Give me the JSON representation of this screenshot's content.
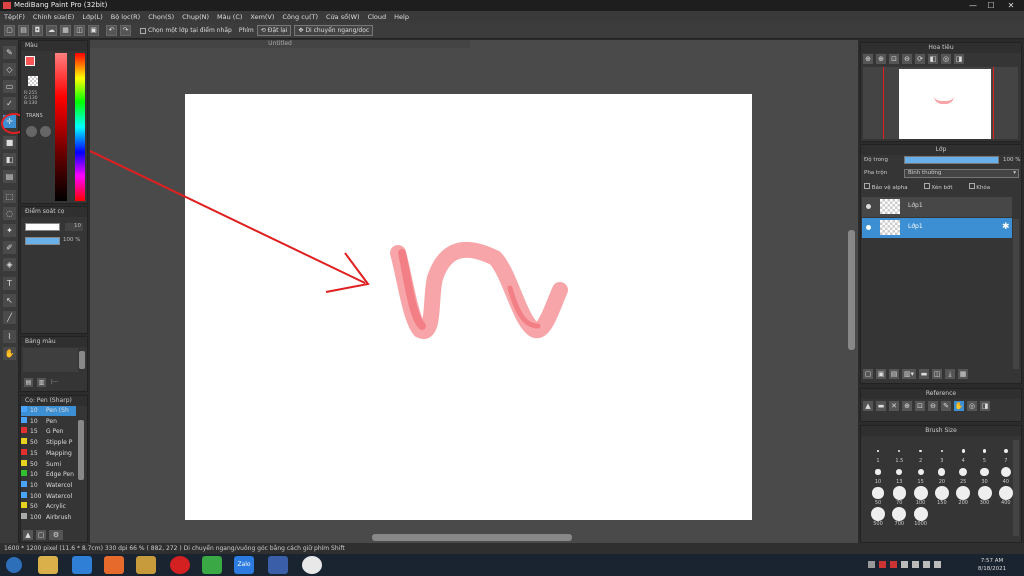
{
  "window": {
    "title": "MediBang Paint Pro (32bit)",
    "min": "—",
    "max": "☐",
    "close": "✕"
  },
  "menu": [
    "Tệp(F)",
    "Chỉnh sửa(E)",
    "Lớp(L)",
    "Bộ lọc(R)",
    "Chọn(S)",
    "Chụp(N)",
    "Màu (C)",
    "Xem(V)",
    "Công cụ(T)",
    "Cửa sổ(W)",
    "Cloud",
    "Help"
  ],
  "toolbar": {
    "select_layer": "Chọn một lớp tại điểm nhấp",
    "key_label": "Phím",
    "rotate": "Đặt lại",
    "move": "Di chuyển ngang/dọc"
  },
  "canvas": {
    "tab": "Untitled"
  },
  "color_panel": {
    "title": "Màu",
    "r": "R:255",
    "g": "G:130",
    "b": "B:130",
    "mode": "TRANS",
    "accent": "#ff8282"
  },
  "brush_control": {
    "title": "Điểm soát cọ",
    "size": "10",
    "opacity": "100 %"
  },
  "palette": {
    "title": "Bảng màu",
    "add_label": "|---"
  },
  "brush_list": {
    "title": "Cọ: Pen (Sharp)",
    "items": [
      {
        "size": "10",
        "name": "Pen (Sh",
        "color": "#4aa3ff"
      },
      {
        "size": "10",
        "name": "Pen",
        "color": "#4aa3ff"
      },
      {
        "size": "15",
        "name": "G Pen",
        "color": "#e03030"
      },
      {
        "size": "50",
        "name": "Stipple P",
        "color": "#e8d020"
      },
      {
        "size": "15",
        "name": "Mapping",
        "color": "#e03030"
      },
      {
        "size": "50",
        "name": "Sumi",
        "color": "#e8d020"
      },
      {
        "size": "10",
        "name": "Edge Pen",
        "color": "#30c030"
      },
      {
        "size": "10",
        "name": "Watercol",
        "color": "#4aa3ff"
      },
      {
        "size": "100",
        "name": "Watercol",
        "color": "#4aa3ff"
      },
      {
        "size": "50",
        "name": "Acrylic",
        "color": "#e8d020"
      },
      {
        "size": "100",
        "name": "Airbrush",
        "color": "#aaaaaa"
      }
    ]
  },
  "navigator": {
    "title": "Hoa tiêu"
  },
  "layer_panel": {
    "title": "Lớp",
    "opacity_label": "Độ trong",
    "opacity_value": "100 %",
    "opacity": 1.0,
    "blend_label": "Pha trộn",
    "blend_value": "Bình thường",
    "protect_alpha": "Bảo vệ alpha",
    "clipping": "Xén bớt",
    "lock": "Khóa",
    "layers": [
      {
        "name": "Lớp1",
        "selected": false
      },
      {
        "name": "Lớp1",
        "selected": true
      }
    ]
  },
  "reference": {
    "title": "Reference"
  },
  "brush_size": {
    "title": "Brush Size",
    "sizes": [
      "1",
      "1.5",
      "2",
      "3",
      "4",
      "5",
      "7",
      "10",
      "13",
      "15",
      "20",
      "25",
      "30",
      "40",
      "50",
      "70",
      "100",
      "150",
      "200",
      "300",
      "400",
      "500",
      "700",
      "1000"
    ]
  },
  "status": {
    "text": "1600 * 1200 pixel  (11.6 * 8.7cm)  330 dpi  66 %  ( 882, 272 )  Di chuyển ngang/vuông góc bằng cách giữ phím Shift"
  },
  "taskbar": {
    "time": "7:57 AM",
    "date": "8/18/2021",
    "zalo": "Zalo"
  }
}
